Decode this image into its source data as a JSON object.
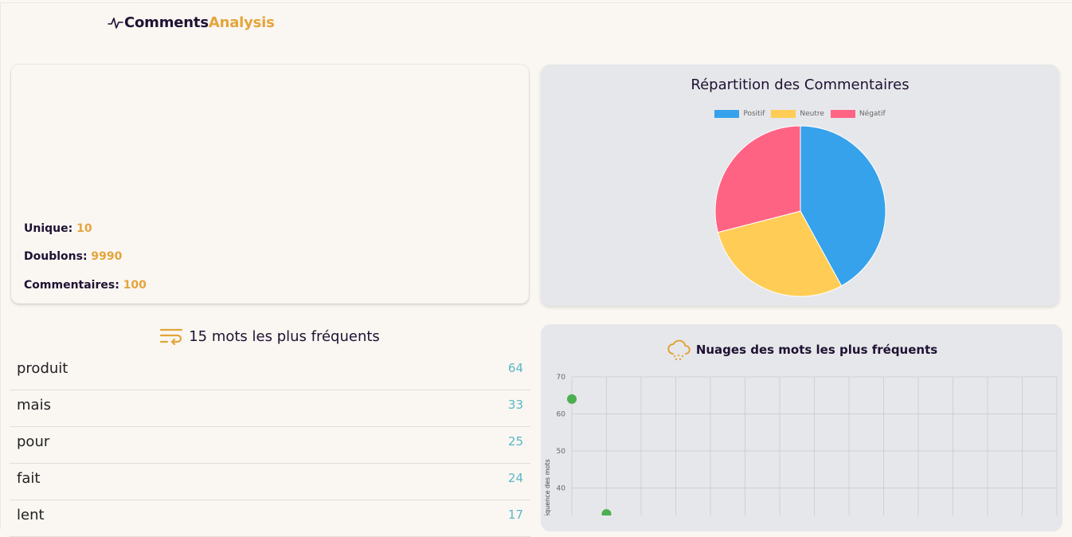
{
  "brand": {
    "part1": "Comments",
    "part2": "Analysis",
    "icon": "pulse-icon"
  },
  "stats": {
    "unique_label": "Unique:",
    "unique_value": "10",
    "doublons_label": "Doublons:",
    "doublons_value": "9990",
    "comments_label": "Commentaires:",
    "comments_value": "100"
  },
  "colors": {
    "accent": "#e3a53b",
    "count": "#5bb7c7",
    "positif": "#36a2eb",
    "neutre": "#ffcd56",
    "negatif": "#ff6384",
    "scatter": "#4caf50"
  },
  "top_words": {
    "title": "15 mots les plus fréquents",
    "icon": "wrap-text-icon",
    "items": [
      {
        "word": "produit",
        "count": "64"
      },
      {
        "word": "mais",
        "count": "33"
      },
      {
        "word": "pour",
        "count": "25"
      },
      {
        "word": "fait",
        "count": "24"
      },
      {
        "word": "lent",
        "count": "17"
      }
    ]
  },
  "cloud": {
    "title": "Nuages des mots les plus fréquents",
    "icon": "cloud-snow-icon"
  },
  "chart_data": [
    {
      "type": "pie",
      "title": "Répartition des Commentaires",
      "categories": [
        "Positif",
        "Neutre",
        "Négatif"
      ],
      "values": [
        42,
        29,
        29
      ],
      "legend": "top"
    },
    {
      "type": "scatter",
      "ylabel": "Fréquence des mots",
      "ylim": [
        30,
        70
      ],
      "yticks": [
        40,
        50,
        60,
        70
      ],
      "grid": true,
      "points": [
        {
          "x": 1,
          "y": 64
        },
        {
          "x": 2,
          "y": 33
        }
      ]
    }
  ]
}
